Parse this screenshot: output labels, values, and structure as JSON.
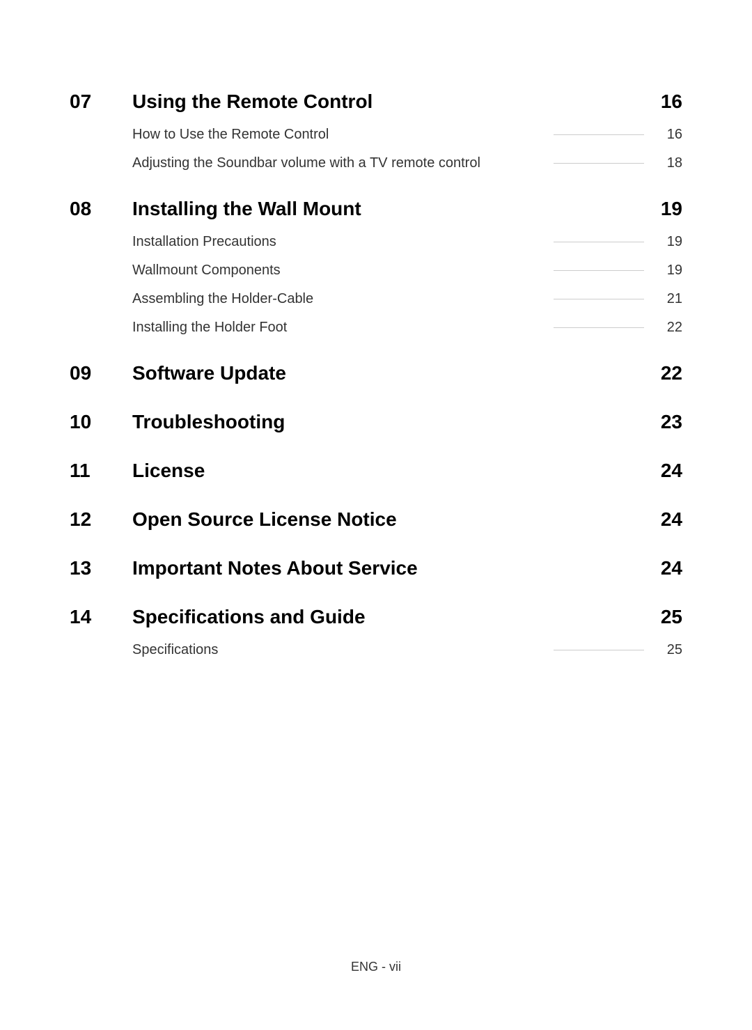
{
  "sections": [
    {
      "number": "07",
      "title": "Using the Remote Control",
      "page": "16",
      "subs": [
        {
          "title": "How to Use the Remote Control",
          "page": "16"
        },
        {
          "title": "Adjusting the Soundbar volume with a TV remote control",
          "page": "18"
        }
      ]
    },
    {
      "number": "08",
      "title": "Installing the Wall Mount",
      "page": "19",
      "subs": [
        {
          "title": "Installation Precautions",
          "page": "19"
        },
        {
          "title": "Wallmount Components",
          "page": "19"
        },
        {
          "title": "Assembling the Holder-Cable",
          "page": "21"
        },
        {
          "title": "Installing the Holder Foot",
          "page": "22"
        }
      ]
    },
    {
      "number": "09",
      "title": "Software Update",
      "page": "22",
      "subs": []
    },
    {
      "number": "10",
      "title": "Troubleshooting",
      "page": "23",
      "subs": []
    },
    {
      "number": "11",
      "title": "License",
      "page": "24",
      "subs": []
    },
    {
      "number": "12",
      "title": "Open Source License Notice",
      "page": "24",
      "subs": []
    },
    {
      "number": "13",
      "title": "Important Notes About Service",
      "page": "24",
      "subs": []
    },
    {
      "number": "14",
      "title": "Specifications and Guide",
      "page": "25",
      "subs": [
        {
          "title": "Specifications",
          "page": "25"
        }
      ]
    }
  ],
  "footer": "ENG - vii"
}
